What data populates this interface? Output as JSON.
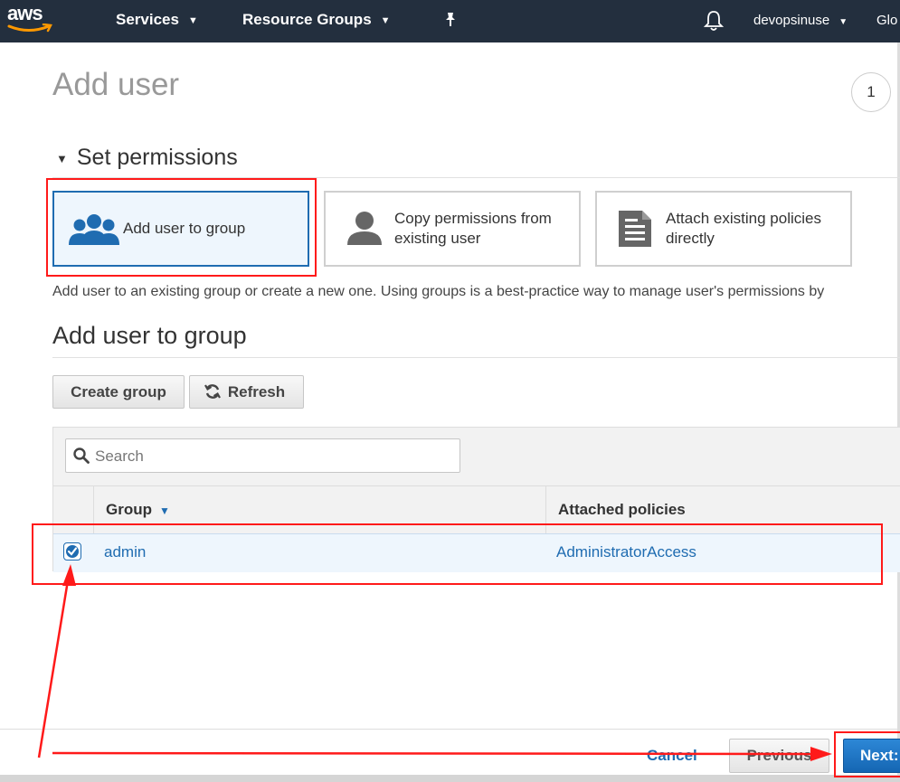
{
  "header": {
    "logo": "aws",
    "services": "Services",
    "resource_groups": "Resource Groups",
    "user": "devopsinuse",
    "region": "Glo"
  },
  "page": {
    "title": "Add user",
    "step": "1"
  },
  "permissions": {
    "heading": "Set permissions",
    "options": [
      {
        "label": "Add user to group",
        "icon": "users-group-icon",
        "selected": true
      },
      {
        "label": "Copy permissions from existing user",
        "icon": "user-icon",
        "selected": false
      },
      {
        "label": "Attach existing policies directly",
        "icon": "document-icon",
        "selected": false
      }
    ],
    "description": "Add user to an existing group or create a new one. Using groups is a best-practice way to manage user's permissions by"
  },
  "group_section": {
    "heading": "Add user to group",
    "create_label": "Create group",
    "refresh_label": "Refresh",
    "search_placeholder": "Search",
    "columns": {
      "group": "Group",
      "policies": "Attached policies"
    },
    "rows": [
      {
        "group": "admin",
        "policies": "AdministratorAccess",
        "checked": true
      }
    ]
  },
  "footer": {
    "cancel": "Cancel",
    "previous": "Previous",
    "next": "Next:"
  },
  "colors": {
    "nav_bg": "#232f3e",
    "accent": "#1f6cb1",
    "annotation": "#ff1a1a"
  }
}
